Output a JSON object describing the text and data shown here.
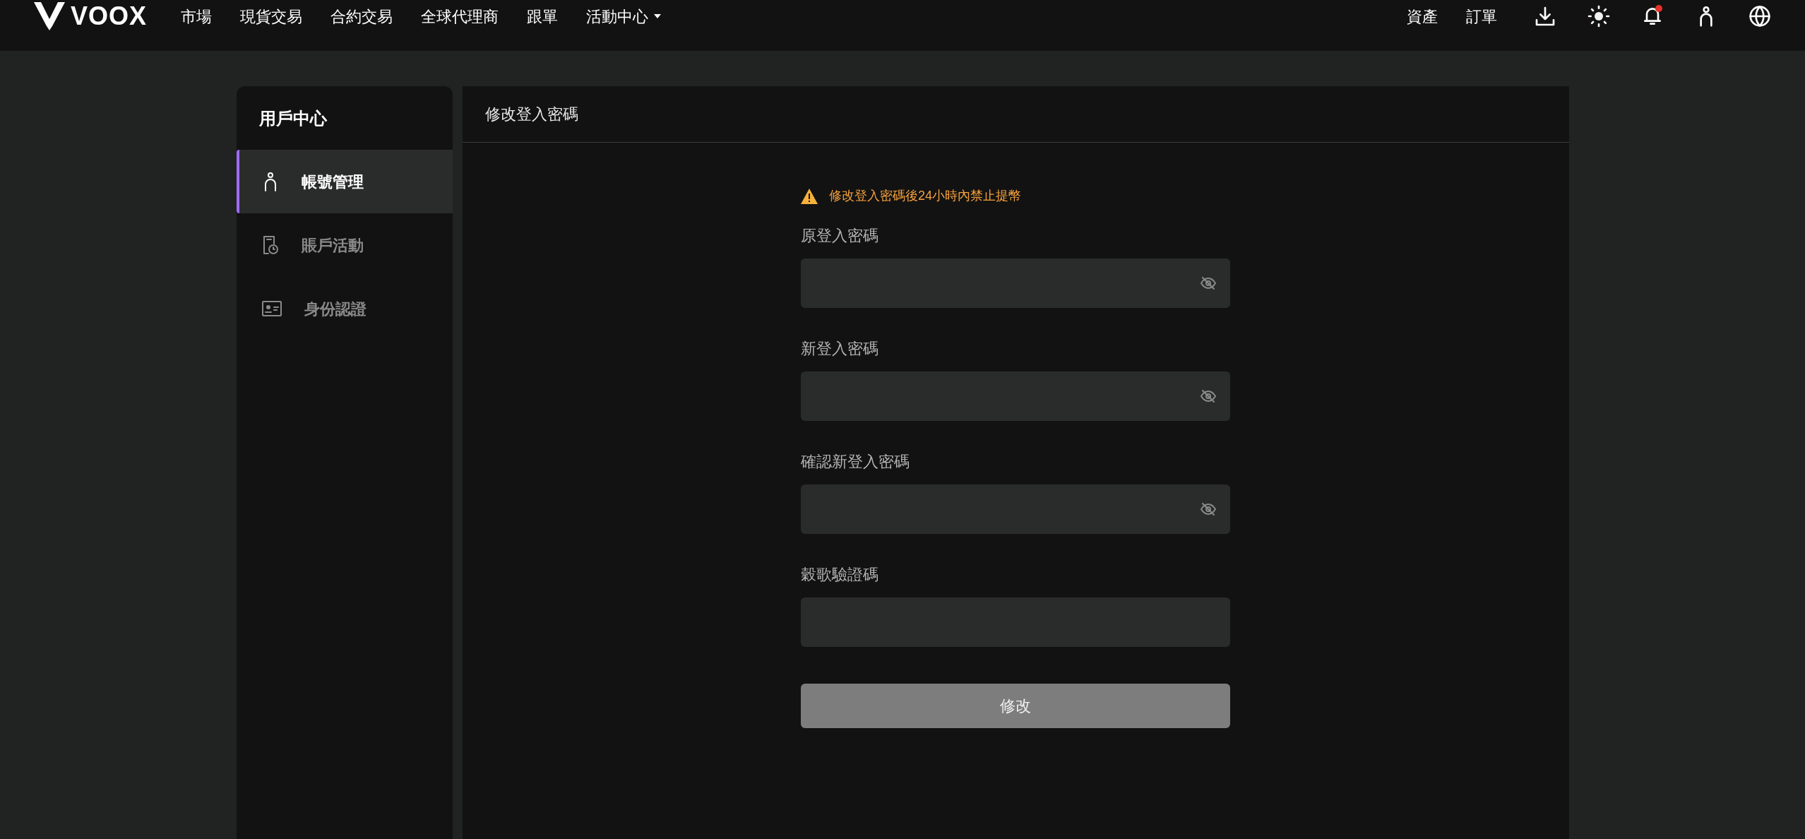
{
  "navbar": {
    "logo": "VOOX",
    "links": [
      {
        "label": "市場",
        "dropdown": false
      },
      {
        "label": "現貨交易",
        "dropdown": false
      },
      {
        "label": "合約交易",
        "dropdown": false
      },
      {
        "label": "全球代理商",
        "dropdown": false
      },
      {
        "label": "跟單",
        "dropdown": false
      },
      {
        "label": "活動中心",
        "dropdown": true
      }
    ],
    "right_links": [
      "資產",
      "訂單"
    ],
    "icons": [
      {
        "kind": "download",
        "alert": false
      },
      {
        "kind": "theme",
        "alert": false
      },
      {
        "kind": "bell",
        "alert": true
      },
      {
        "kind": "user",
        "alert": false
      },
      {
        "kind": "globe",
        "alert": false
      }
    ]
  },
  "sidebar": {
    "title": "用戶中心",
    "items": [
      {
        "label": "帳號管理",
        "selected": true
      },
      {
        "label": "賬戶活動",
        "selected": false
      },
      {
        "label": "身份認證",
        "selected": false
      }
    ]
  },
  "panel": {
    "title": "修改登入密碼",
    "warning": "修改登入密碼後24小時內禁止提幣",
    "fields": [
      {
        "label": "原登入密碼",
        "toggle": true
      },
      {
        "label": "新登入密碼",
        "toggle": true
      },
      {
        "label": "確認新登入密碼",
        "toggle": true
      },
      {
        "label": "穀歌驗證碼",
        "toggle": false
      }
    ],
    "submit": {
      "label": "修改",
      "disabled": true
    }
  }
}
